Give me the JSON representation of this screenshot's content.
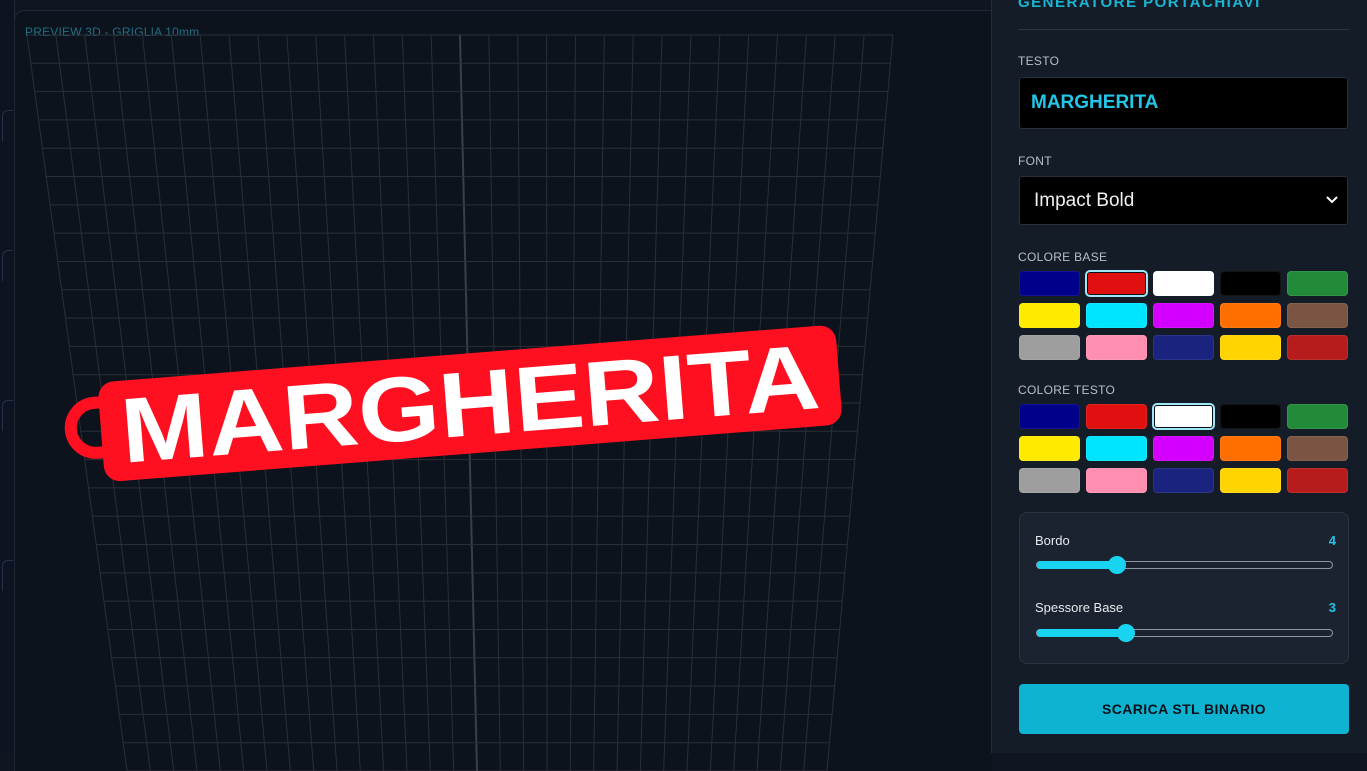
{
  "viewport": {
    "label": "PREVIEW 3D - GRIGLIA 10mm",
    "keychain_text": "MARGHERITA"
  },
  "panel": {
    "title": "GENERATORE PORTACHIAVI",
    "text_label": "TESTO",
    "text_value": "MARGHERITA",
    "font_label": "FONT",
    "font_value": "Impact Bold",
    "base_color_label": "COLORE BASE",
    "text_color_label": "COLORE TESTO",
    "palette": [
      "#00008b",
      "#e01010",
      "#ffffff",
      "#000000",
      "#228b3a",
      "#ffea00",
      "#00e5ff",
      "#d400ff",
      "#ff6f00",
      "#7a5544",
      "#9e9e9e",
      "#ff8fb1",
      "#1a237e",
      "#ffd400",
      "#b71c1c"
    ],
    "base_selected_index": 1,
    "text_selected_index": 2,
    "sliders": [
      {
        "label": "Bordo",
        "value": "4",
        "fraction": 0.27
      },
      {
        "label": "Spessore Base",
        "value": "3",
        "fraction": 0.3
      }
    ],
    "download_label": "SCARICA STL BINARIO"
  },
  "colors": {
    "accent": "#19d4f0",
    "keychain_base": "#ff1020",
    "keychain_text": "#ffffff"
  }
}
